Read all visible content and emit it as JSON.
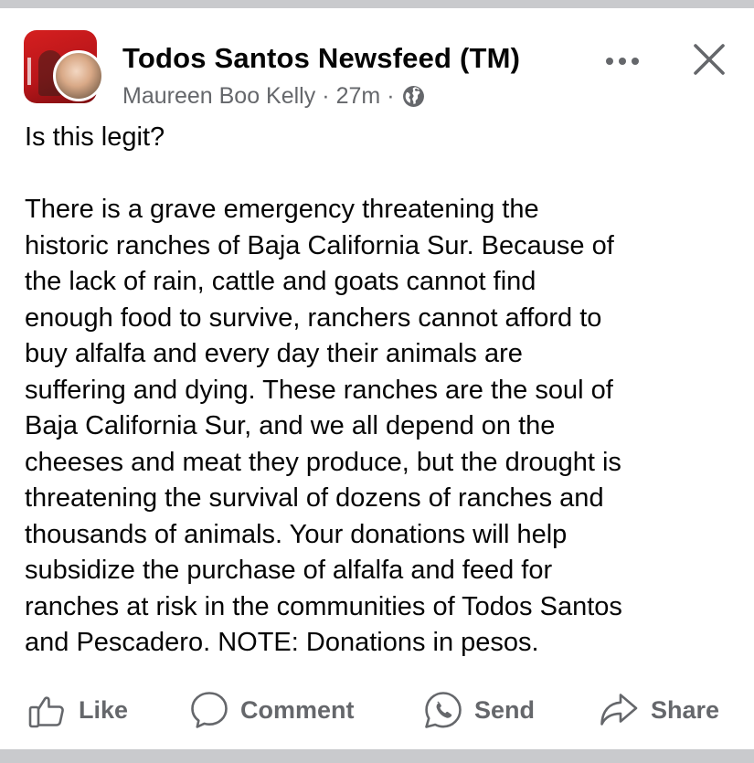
{
  "post": {
    "group_name": "Todos Santos Newsfeed (TM)",
    "author": "Maureen Boo Kelly",
    "separator": "·",
    "time": "27m",
    "privacy_icon": "globe-icon",
    "body_lines": [
      "Is this legit?",
      "",
      "There is a grave emergency threatening the",
      "historic ranches of Baja California Sur. Because of",
      "the lack of rain, cattle and goats cannot find",
      "enough food to survive, ranchers cannot afford to",
      "buy alfalfa and every day their animals are",
      "suffering and dying. These ranches are the soul of",
      "Baja California Sur, and we all depend on the",
      "cheeses and meat they produce, but the drought is",
      "threatening the survival of dozens of ranches and",
      "thousands of animals. Your donations will help",
      "subsidize the purchase of alfalfa and feed for",
      "ranches at risk in the communities of Todos Santos",
      "and Pescadero. NOTE: Donations in pesos."
    ]
  },
  "header_actions": {
    "more_icon": "more-horizontal-icon",
    "close_icon": "close-icon"
  },
  "actions": {
    "like_label": "Like",
    "comment_label": "Comment",
    "send_label": "Send",
    "share_label": "Share"
  },
  "colors": {
    "text_primary": "#050505",
    "text_secondary": "#65676b",
    "background_page": "#c9cacd",
    "card": "#ffffff",
    "group_avatar_red": "#d51f1f"
  }
}
